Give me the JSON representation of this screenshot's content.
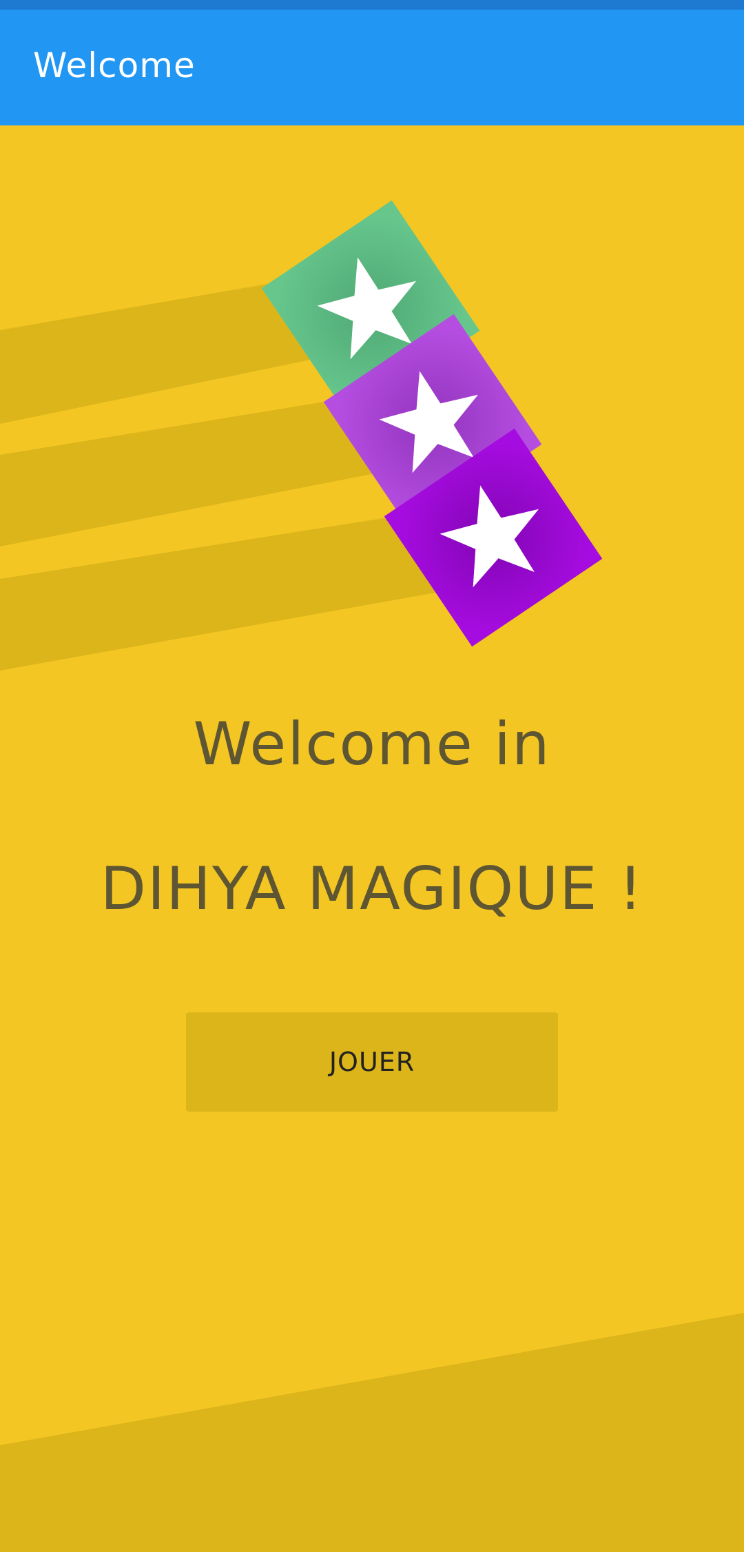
{
  "app_bar": {
    "title": "Welcome"
  },
  "main": {
    "welcome_text": "Welcome in",
    "game_title": "DIHYA MAGIQUE !",
    "play_button_label": "JOUER"
  },
  "logo": {
    "tiles": [
      {
        "color": "#66C68C",
        "icon": "star-icon"
      },
      {
        "color": "#B44DE0",
        "icon": "star-icon"
      },
      {
        "color": "#A50CDF",
        "icon": "star-icon"
      }
    ]
  },
  "colors": {
    "background": "#F3C623",
    "stripes": "#DCB51B",
    "app_bar": "#2196F3",
    "status_bar": "#1E7AD0",
    "text": "#5E5632"
  }
}
